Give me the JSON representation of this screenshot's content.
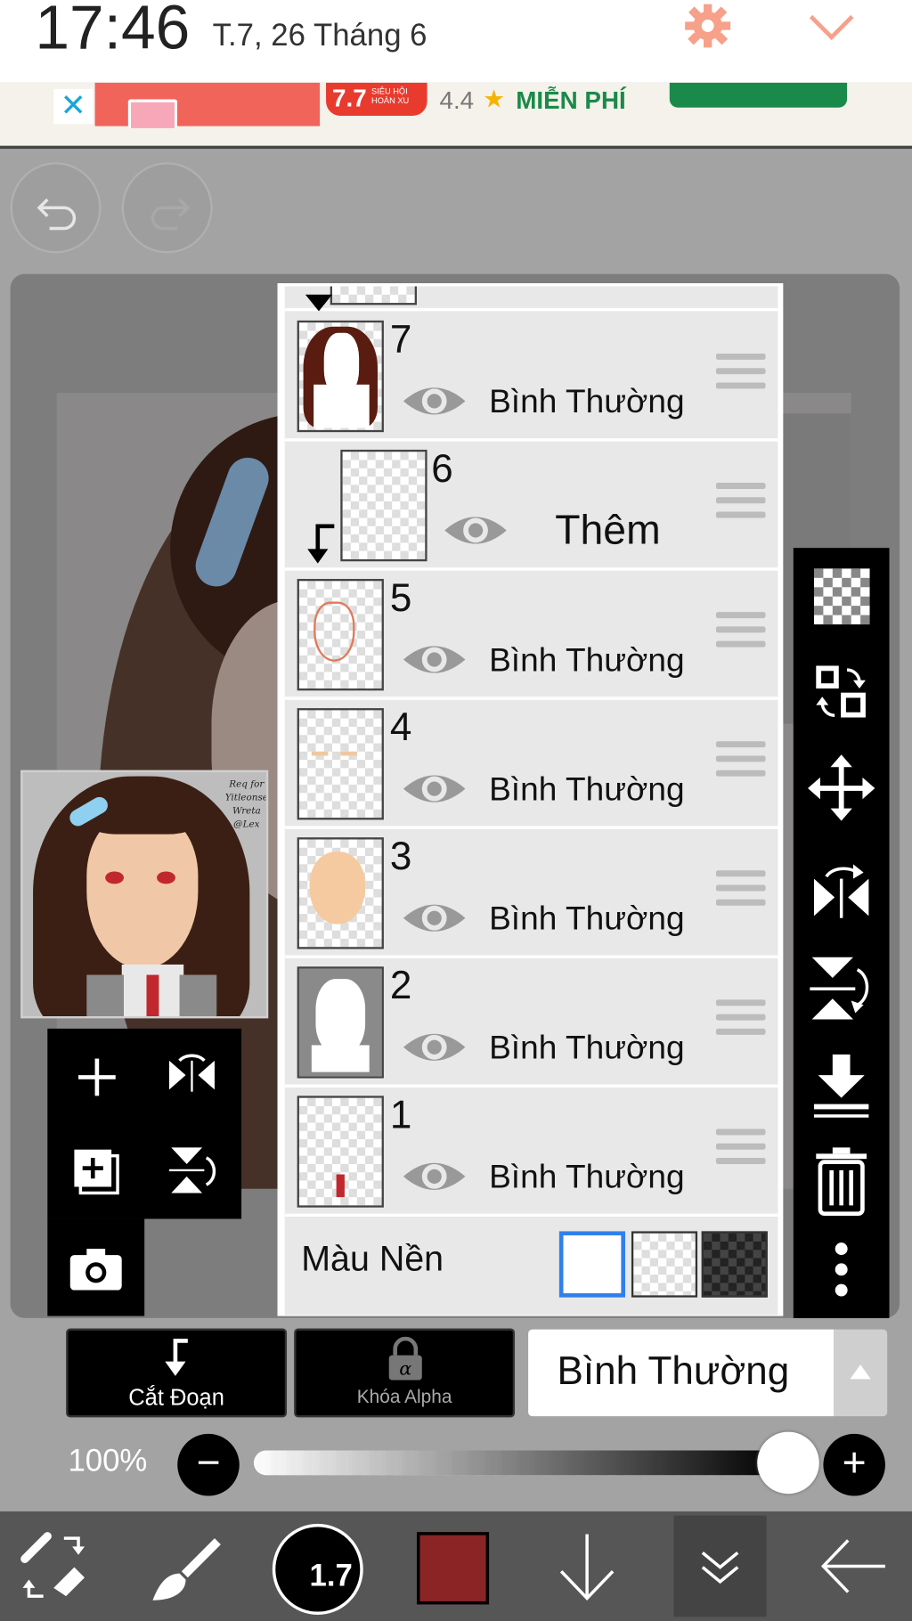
{
  "status": {
    "time": "17:46",
    "date": "T.7, 26 Tháng 6",
    "gear_color": "#f7a08a"
  },
  "ad": {
    "close": "✕",
    "badge_num": "7.7",
    "badge_text": "SIÊU HỘI HOÀN XU",
    "rating": "4.4",
    "star": "★",
    "free": "MIỄN PHÍ"
  },
  "preview_text": "Req for Yitleonse Wreta @Lex",
  "layers": [
    {
      "num": "7",
      "mode": "Bình Thường"
    },
    {
      "num": "6",
      "mode": "Thêm"
    },
    {
      "num": "5",
      "mode": "Bình Thường"
    },
    {
      "num": "4",
      "mode": "Bình Thường"
    },
    {
      "num": "3",
      "mode": "Bình Thường"
    },
    {
      "num": "2",
      "mode": "Bình Thường"
    },
    {
      "num": "1",
      "mode": "Bình Thường"
    }
  ],
  "background_label": "Màu Nền",
  "blend": {
    "clipping": "Cắt Đoạn",
    "alpha_lock": "Khóa Alpha",
    "mode": "Bình Thường"
  },
  "opacity": {
    "label": "100%",
    "value": 1.0
  },
  "brush": {
    "size": "1.7"
  },
  "colors": {
    "current": "#8b2525",
    "accent": "#2f80ed"
  }
}
